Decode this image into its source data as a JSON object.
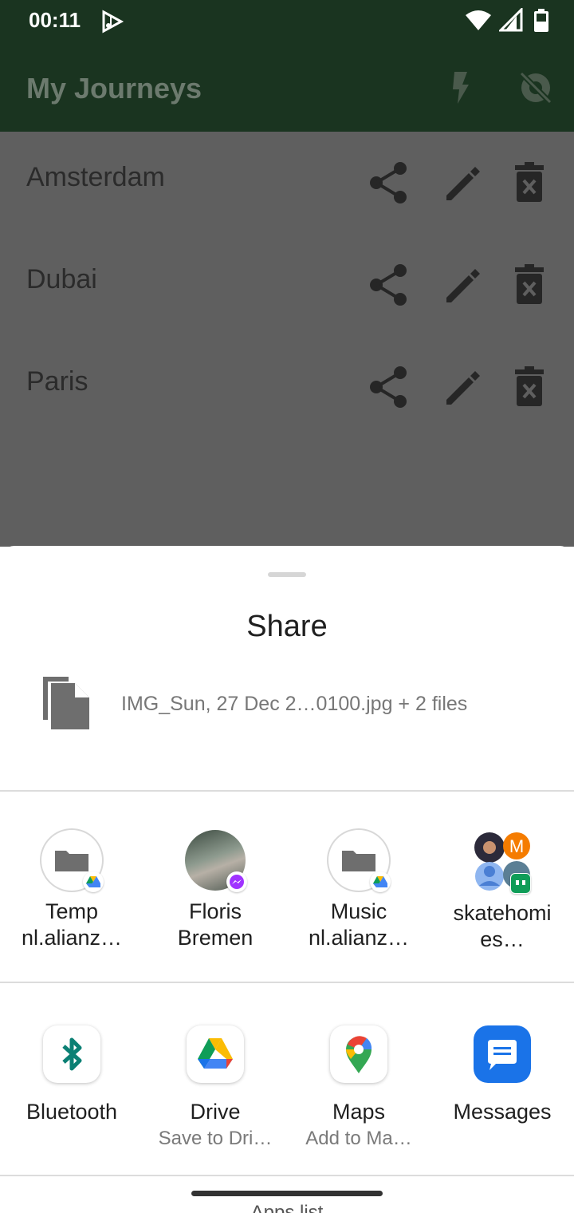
{
  "status_bar": {
    "time": "00:11"
  },
  "app_bar": {
    "title": "My Journeys"
  },
  "journeys": [
    {
      "name": "Amsterdam"
    },
    {
      "name": "Dubai"
    },
    {
      "name": "Paris"
    }
  ],
  "share_sheet": {
    "title": "Share",
    "file_label": "IMG_Sun, 27 Dec 2…0100.jpg + 2 files",
    "direct_targets": [
      {
        "line1": "Temp",
        "line2": "nl.alianz…",
        "icon": "folder-icon",
        "badge": "drive-badge-icon"
      },
      {
        "line1": "Floris",
        "line2": "Bremen",
        "icon": "contact-avatar",
        "badge": "messenger-badge-icon"
      },
      {
        "line1": "Music",
        "line2": "nl.alianz…",
        "icon": "folder-icon",
        "badge": "drive-badge-icon"
      },
      {
        "line1": "skatehomi",
        "line2": "es…",
        "icon": "group-avatar",
        "badge": "hangouts-badge-icon"
      }
    ],
    "apps": [
      {
        "name": "Bluetooth",
        "sub": "",
        "icon": "bluetooth-icon"
      },
      {
        "name": "Drive",
        "sub": "Save to Dri…",
        "icon": "drive-icon"
      },
      {
        "name": "Maps",
        "sub": "Add to Ma…",
        "icon": "maps-icon"
      },
      {
        "name": "Messages",
        "sub": "",
        "icon": "messages-icon"
      }
    ],
    "apps_list_label": "Apps list"
  },
  "colors": {
    "app_bar": "#1a3420",
    "scrim_list": "#5f5f5f",
    "messages_blue": "#1a73e8",
    "bluetooth_teal": "#0b8074"
  }
}
